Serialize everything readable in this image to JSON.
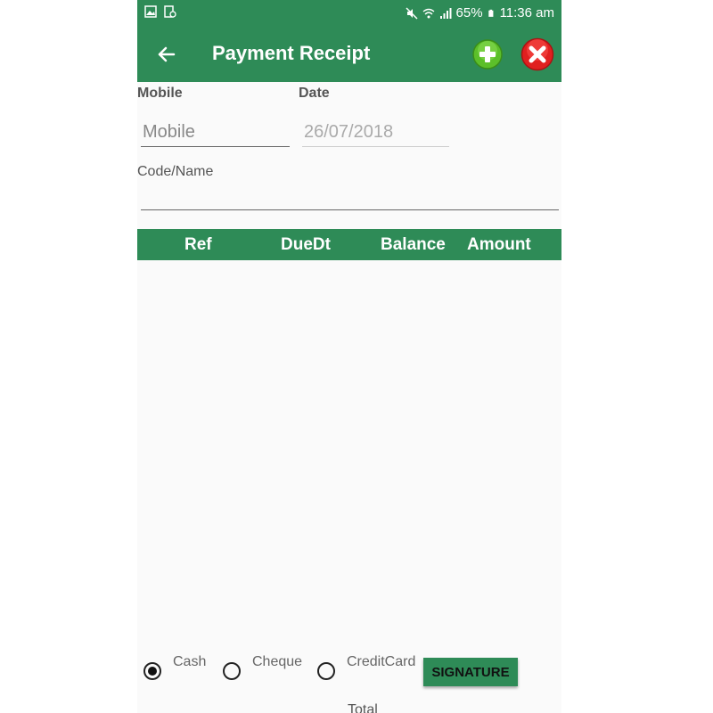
{
  "status_bar": {
    "battery": "65%",
    "time": "11:36 am",
    "icons": [
      "image-icon",
      "screenshot-icon",
      "mute-icon",
      "wifi-icon",
      "signal-icon",
      "battery-icon"
    ]
  },
  "app_bar": {
    "title": "Payment Receipt",
    "color": "#2e8b57"
  },
  "form": {
    "mobile_label": "Mobile",
    "mobile_placeholder": "Mobile",
    "mobile_value": "",
    "date_label": "Date",
    "date_placeholder": "26/07/2018",
    "code_label": "Code/Name",
    "code_value": ""
  },
  "table": {
    "headers": [
      "Ref",
      "DueDt",
      "Balance",
      "Amount"
    ],
    "rows": []
  },
  "payment": {
    "options": [
      "Cash",
      "Cheque",
      "CreditCard"
    ],
    "selected": "Cash",
    "signature_label": "SIGNATURE",
    "total_label": "Total"
  }
}
